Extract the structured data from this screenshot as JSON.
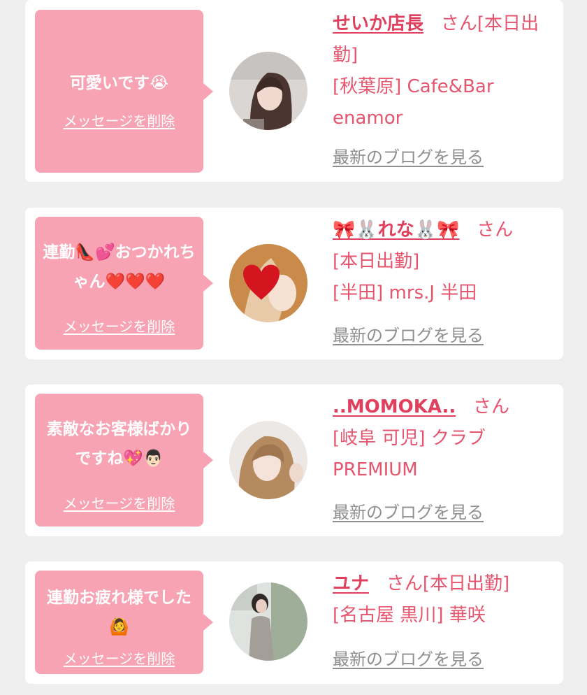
{
  "delete_label": "メッセージを削除",
  "blog_label": "最新のブログを見る",
  "suffix": "さん",
  "colors": {
    "bubble": "#f7a3b3",
    "name": "#e0405e",
    "info": "#e5556e",
    "blog": "#8f8f8f",
    "background": "#efefef"
  },
  "cards": [
    {
      "message": "可愛いです😭",
      "name": "せいか店長",
      "status": "[本日出勤]",
      "location": "[秋葉原] Cafe&Bar enamor",
      "avatar": "woman-long-hair-photo"
    },
    {
      "message": "連勤👠💕おつかれちゃん❤️❤️❤️",
      "name": "🎀🐰れな🐰🎀",
      "status": "[本日出勤]",
      "location": "[半田] mrs.J 半田",
      "avatar": "heart-covered-face-photo"
    },
    {
      "message": "素敵なお客様ばかりですね💖👨🏻",
      "name": "..MOMOKA..",
      "status": "",
      "location": "[岐阜 可児] クラブ PREMIUM",
      "avatar": "woman-blonde-hair-photo"
    },
    {
      "message": "連勤お疲れ様でした🙆",
      "name": "ユナ",
      "status": "[本日出勤]",
      "location": "[名古屋 黒川] 華咲",
      "avatar": "woman-standing-photo"
    }
  ]
}
